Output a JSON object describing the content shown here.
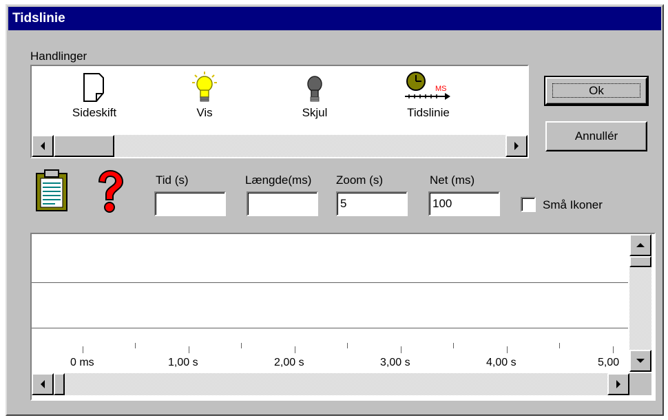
{
  "window": {
    "title": "Tidslinie"
  },
  "actions": {
    "group_label": "Handlinger",
    "items": [
      {
        "label": "Sideskift",
        "icon": "page-break-icon"
      },
      {
        "label": "Vis",
        "icon": "lightbulb-on-icon"
      },
      {
        "label": "Skjul",
        "icon": "lightbulb-off-icon"
      },
      {
        "label": "Tidslinie",
        "icon": "timeline-clock-icon",
        "icon_text": "MS"
      }
    ]
  },
  "buttons": {
    "ok": "Ok",
    "cancel": "Annullér"
  },
  "fields": {
    "time": {
      "label": "Tid (s)",
      "value": ""
    },
    "length": {
      "label": "Længde(ms)",
      "value": ""
    },
    "zoom": {
      "label": "Zoom (s)",
      "value": "5"
    },
    "grid": {
      "label": "Net (ms)",
      "value": "100"
    }
  },
  "small_icons": {
    "label": "Små Ikoner",
    "checked": false
  },
  "timeline": {
    "ticks": [
      "0 ms",
      "1,00 s",
      "2,00 s",
      "3,00 s",
      "4,00 s",
      "5,00"
    ]
  },
  "colors": {
    "titlebar": "#000080",
    "face": "#c0c0c0",
    "bulb_on": "#ffff00",
    "help": "#ff0000",
    "ms_label": "#ff0000"
  }
}
